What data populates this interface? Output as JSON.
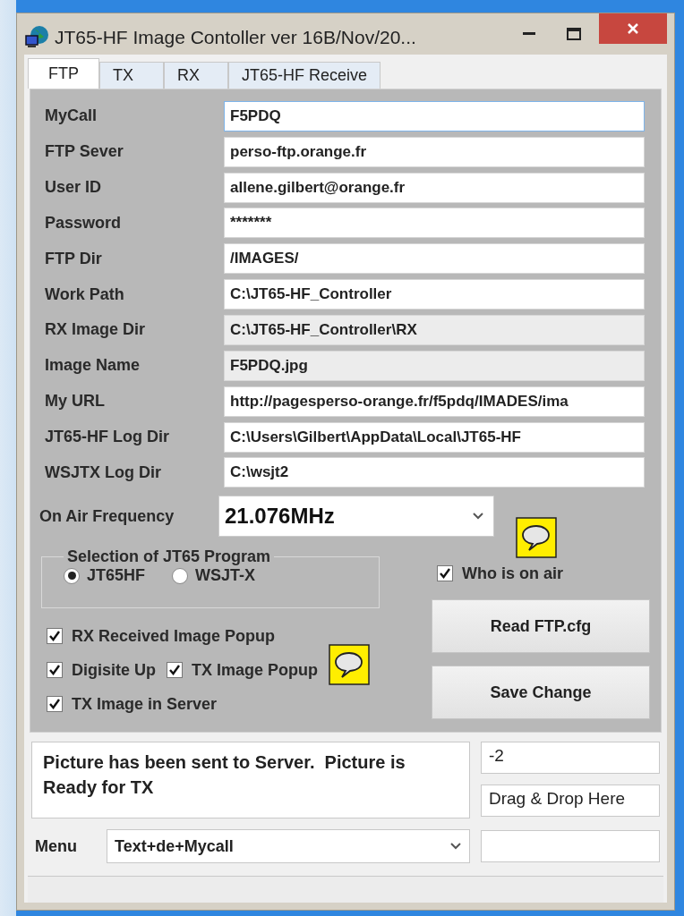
{
  "window": {
    "title": "JT65-HF Image Contoller ver 16B/Nov/20..."
  },
  "tabs": [
    {
      "label": "FTP",
      "selected": true
    },
    {
      "label": "TX",
      "selected": false
    },
    {
      "label": "RX",
      "selected": false
    },
    {
      "label": "JT65-HF Receive",
      "selected": false
    }
  ],
  "fields": [
    {
      "label": "MyCall",
      "value": "F5PDQ",
      "readonly": false,
      "focused": true
    },
    {
      "label": "FTP Sever",
      "value": "perso-ftp.orange.fr",
      "readonly": false,
      "focused": false
    },
    {
      "label": "User ID",
      "value": "allene.gilbert@orange.fr",
      "readonly": false,
      "focused": false
    },
    {
      "label": "Password",
      "value": "*******",
      "readonly": false,
      "focused": false
    },
    {
      "label": "FTP Dir",
      "value": "/IMAGES/",
      "readonly": false,
      "focused": false
    },
    {
      "label": "Work Path",
      "value": "C:\\JT65-HF_Controller",
      "readonly": false,
      "focused": false
    },
    {
      "label": "RX Image Dir",
      "value": "C:\\JT65-HF_Controller\\RX",
      "readonly": true,
      "focused": false
    },
    {
      "label": "Image Name",
      "value": "F5PDQ.jpg",
      "readonly": true,
      "focused": false
    },
    {
      "label": "My URL",
      "value": "http://pagesperso-orange.fr/f5pdq/IMADES/ima",
      "readonly": false,
      "focused": false
    },
    {
      "label": "JT65-HF Log Dir",
      "value": "C:\\Users\\Gilbert\\AppData\\Local\\JT65-HF",
      "readonly": false,
      "focused": false
    },
    {
      "label": "WSJTX Log Dir",
      "value": "C:\\wsjt2",
      "readonly": false,
      "focused": false
    }
  ],
  "frequency": {
    "label": "On Air Frequency",
    "value": "21.076MHz"
  },
  "program_group": {
    "title": "Selection of JT65 Program",
    "options": [
      {
        "label": "JT65HF",
        "selected": true
      },
      {
        "label": "WSJT-X",
        "selected": false
      }
    ]
  },
  "who_on_air": {
    "label": "Who is on air",
    "checked": true
  },
  "checkbox_rows": [
    {
      "items": [
        {
          "label": "RX Received Image Popup",
          "checked": true
        }
      ]
    },
    {
      "items": [
        {
          "label": "Digisite Up",
          "checked": true
        },
        {
          "label": "TX Image Popup",
          "checked": true
        }
      ]
    },
    {
      "items": [
        {
          "label": "TX Image in Server",
          "checked": true
        }
      ]
    }
  ],
  "buttons": [
    "Read FTP.cfg",
    "Save Change"
  ],
  "message": "Picture has been sent to Server.  Picture is Ready for TX",
  "counter": "-2",
  "drop_target": "Drag & Drop Here",
  "menu": {
    "label": "Menu",
    "value": "Text+de+Mycall"
  }
}
